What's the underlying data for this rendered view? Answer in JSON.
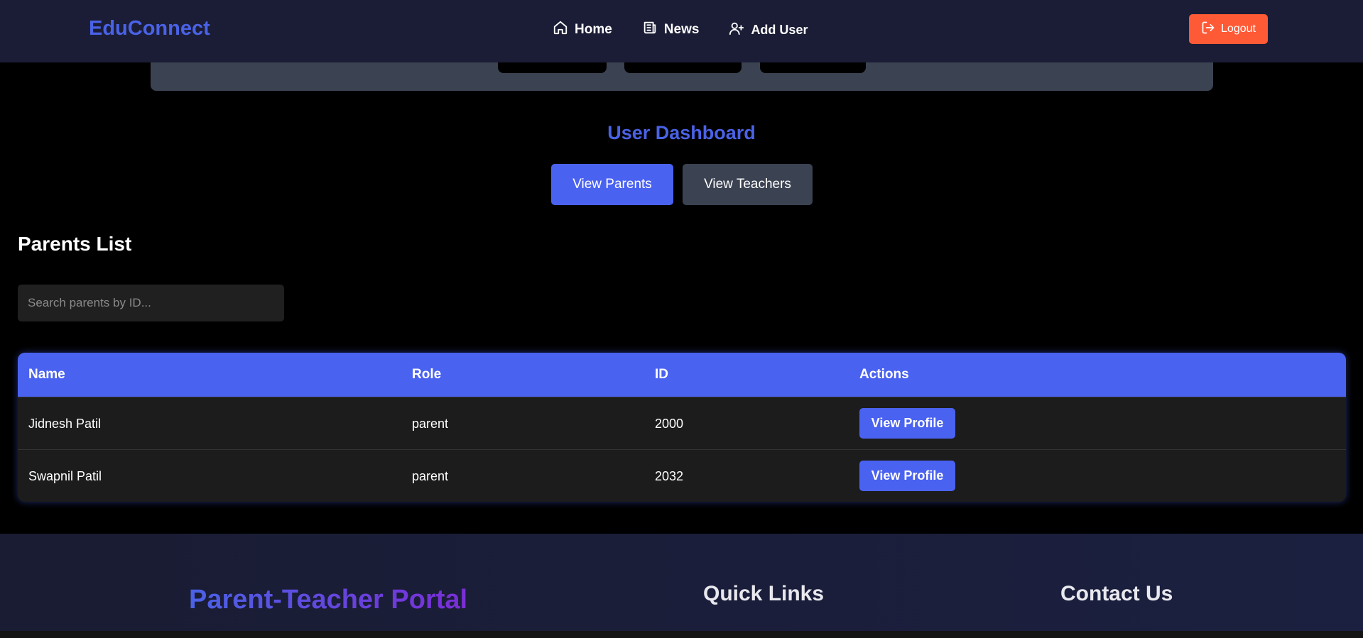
{
  "navbar": {
    "brand": "EduConnect",
    "links": [
      {
        "label": "Home",
        "icon": "home-icon"
      },
      {
        "label": "News",
        "icon": "newspaper-icon"
      },
      {
        "label": "Add User",
        "icon": "user-plus-icon"
      }
    ],
    "logout_label": "Logout"
  },
  "dashboard": {
    "title": "User Dashboard",
    "tabs": {
      "parents": "View Parents",
      "teachers": "View Teachers"
    }
  },
  "parents": {
    "title": "Parents List",
    "search_placeholder": "Search parents by ID...",
    "columns": [
      "Name",
      "Role",
      "ID",
      "Actions"
    ],
    "rows": [
      {
        "name": "Jidnesh Patil",
        "role": "parent",
        "id": "2000",
        "action": "View Profile"
      },
      {
        "name": "Swapnil Patil",
        "role": "parent",
        "id": "2032",
        "action": "View Profile"
      }
    ]
  },
  "footer": {
    "portal_title": "Parent-Teacher Portal",
    "quick_links": "Quick Links",
    "contact": "Contact Us"
  },
  "colors": {
    "accent": "#4a62f0",
    "logout": "#ff5a36",
    "navbar_bg": "#1b1d36",
    "secondary_button": "#3b4252"
  }
}
